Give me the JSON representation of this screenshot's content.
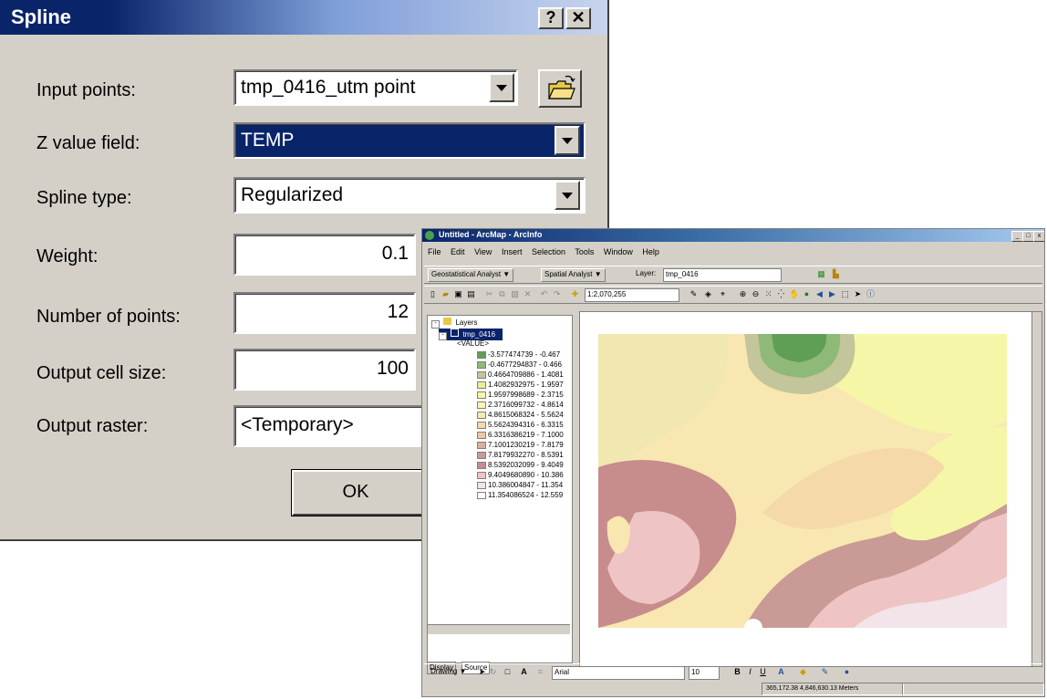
{
  "spline_dialog": {
    "title": "Spline",
    "help_button": "?",
    "close_button": "✕",
    "fields": {
      "input_points": {
        "label": "Input points:",
        "value": "tmp_0416_utm point"
      },
      "z_value_field": {
        "label": "Z value field:",
        "value": "TEMP"
      },
      "spline_type": {
        "label": "Spline type:",
        "value": "Regularized"
      },
      "weight": {
        "label": "Weight:",
        "value": "0.1"
      },
      "number_of_points": {
        "label": "Number of points:",
        "value": "12"
      },
      "output_cell_size": {
        "label": "Output cell size:",
        "value": "100"
      },
      "output_raster": {
        "label": "Output raster:",
        "value": "<Temporary>"
      }
    },
    "ok_label": "OK",
    "icons": {
      "browse": "open-folder-icon",
      "dropdown": "dropdown-arrow-icon"
    }
  },
  "arcmap": {
    "title": "Untitled - ArcMap - ArcInfo",
    "window_buttons": [
      "_",
      "□",
      "x"
    ],
    "menu": [
      "File",
      "Edit",
      "View",
      "Insert",
      "Selection",
      "Tools",
      "Window",
      "Help"
    ],
    "toolbar1": {
      "geostatistical": "Geostatistical Analyst ▼",
      "spatial": "Spatial Analyst ▼",
      "layer_label": "Layer:",
      "layer_value": "tmp_0416"
    },
    "toolbar2": {
      "scale": "1:2,070,255"
    },
    "toc": {
      "root": "Layers",
      "layer": "tmp_0416",
      "field": "<VALUE>",
      "classes": [
        {
          "label": "-3.577474739 - -0.467",
          "color": "#5f9e55"
        },
        {
          "label": "-0.4677294837 - 0.466",
          "color": "#8fb978"
        },
        {
          "label": "0.4664709886 - 1.4081",
          "color": "#c3c59a"
        },
        {
          "label": "1.4082932975 - 1.9597",
          "color": "#ecec9a"
        },
        {
          "label": "1.9597998689 - 2.3715",
          "color": "#f6f6a8"
        },
        {
          "label": "2.3716099732 - 4.8614",
          "color": "#fbf5b3"
        },
        {
          "label": "4.8615068324 - 5.5624",
          "color": "#f8e7b0"
        },
        {
          "label": "5.5624394316 - 6.3315",
          "color": "#f5d9a8"
        },
        {
          "label": "6.3316386219 - 7.1000",
          "color": "#f0c8a0"
        },
        {
          "label": "7.1001230219 - 7.8179",
          "color": "#d8b0a0"
        },
        {
          "label": "7.8179932270 - 8.5391",
          "color": "#c99a96"
        },
        {
          "label": "8.5392032099 - 9.4049",
          "color": "#c78c8c"
        },
        {
          "label": "9.4049680890 - 10.386",
          "color": "#efc4c4"
        },
        {
          "label": "10.386004847 - 11.354",
          "color": "#f2e4e8"
        },
        {
          "label": "11.354086524 - 12.559",
          "color": "#ffffff"
        }
      ],
      "tabs": [
        "Display",
        "Source"
      ]
    },
    "drawing": {
      "label": "Drawing ▼",
      "font": "Arial",
      "size": "10",
      "bold": "B",
      "italic": "I",
      "underline": "U"
    },
    "status": {
      "coords": "365,172.38  4,846,630.13 Meters"
    }
  }
}
